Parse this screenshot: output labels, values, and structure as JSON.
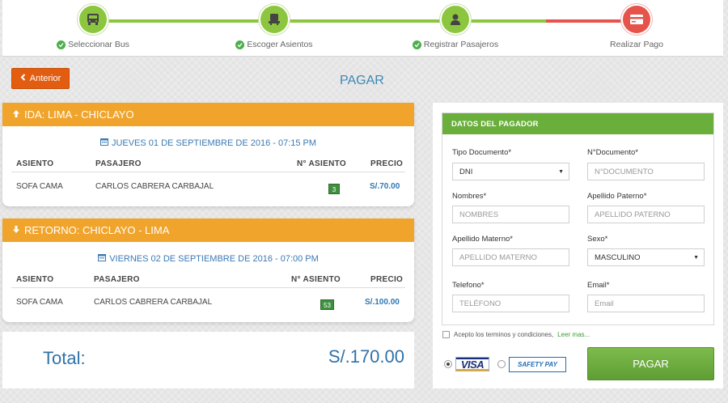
{
  "stepper": {
    "steps": [
      {
        "label": "Seleccionar Bus",
        "icon": "bus-icon",
        "done": true
      },
      {
        "label": "Escoger Asientos",
        "icon": "seat-icon",
        "done": true
      },
      {
        "label": "Registrar Pasajeros",
        "icon": "user-icon",
        "done": true
      },
      {
        "label": "Realizar Pago",
        "icon": "credit-card-icon",
        "done": false
      }
    ],
    "colors": {
      "done": "#8cc63f",
      "current": "#e5534b"
    }
  },
  "nav": {
    "back_label": "Anterior",
    "page_title": "PAGAR"
  },
  "trips": [
    {
      "title": "IDA: LIMA - CHICLAYO",
      "direction_icon": "arrow-up-icon",
      "date": "JUEVES 01 DE SEPTIEMBRE DE 2016 - 07:15 PM",
      "headers": [
        "ASIENTO",
        "PASAJERO",
        "N° ASIENTO",
        "PRECIO"
      ],
      "rows": [
        {
          "asiento": "SOFA CAMA",
          "pasajero": "CARLOS CABRERA CARBAJAL",
          "num": "3",
          "precio": "S/.70.00"
        }
      ]
    },
    {
      "title": "RETORNO: CHICLAYO - LIMA",
      "direction_icon": "arrow-down-icon",
      "date": "VIERNES 02 DE SEPTIEMBRE DE 2016 - 07:00 PM",
      "headers": [
        "ASIENTO",
        "PASAJERO",
        "N° ASIENTO",
        "PRECIO"
      ],
      "rows": [
        {
          "asiento": "SOFA CAMA",
          "pasajero": "CARLOS CABRERA CARBAJAL",
          "num": "53",
          "precio": "S/.100.00"
        }
      ]
    }
  ],
  "total": {
    "label": "Total:",
    "amount": "S/.170.00"
  },
  "payer": {
    "title": "DATOS DEL PAGADOR",
    "fields": {
      "tipo_documento": {
        "label": "Tipo Documento*",
        "value": "DNI"
      },
      "num_documento": {
        "label": "N°Documento*",
        "placeholder": "N°DOCUMENTO"
      },
      "nombres": {
        "label": "Nombres*",
        "placeholder": "NOMBRES"
      },
      "apellido_paterno": {
        "label": "Apellido Paterno*",
        "placeholder": "APELLIDO PATERNO"
      },
      "apellido_materno": {
        "label": "Apellido Materno*",
        "placeholder": "APELLIDO MATERNO"
      },
      "sexo": {
        "label": "Sexo*",
        "value": "MASCULINO"
      },
      "telefono": {
        "label": "Telefono*",
        "placeholder": "TELÉFONO"
      },
      "email": {
        "label": "Email*",
        "placeholder": "Email"
      }
    },
    "terms_text": "Acepto los terminos y condiciones,",
    "terms_link": "Leer mas...",
    "payment_methods": [
      "VISA",
      "SAFETY PAY"
    ],
    "pay_label": "PAGAR"
  },
  "colors": {
    "accent_orange": "#f0a42c",
    "accent_green": "#6aaf3c",
    "link_blue": "#2f77b6"
  }
}
